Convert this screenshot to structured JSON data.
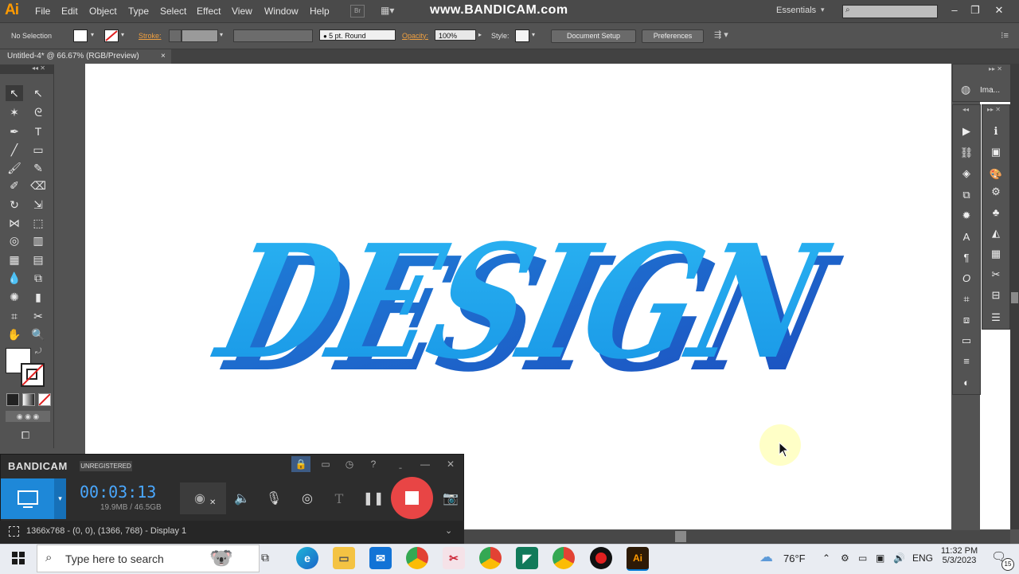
{
  "app": {
    "logo": "Ai",
    "menus": [
      "File",
      "Edit",
      "Object",
      "Type",
      "Select",
      "Effect",
      "View",
      "Window",
      "Help"
    ],
    "watermark": "www.BANDICAM.com",
    "workspace": "Essentials",
    "search_placeholder": ""
  },
  "control_bar": {
    "selection": "No Selection",
    "stroke_label": "Stroke:",
    "brush": "5 pt. Round",
    "opacity_label": "Opacity:",
    "opacity_value": "100%",
    "style_label": "Style:",
    "document_setup": "Document Setup",
    "preferences": "Preferences"
  },
  "document": {
    "tab_title": "Untitled-4* @ 66.67% (RGB/Preview)",
    "tab_close": "×",
    "artwork_text": "DESIGN"
  },
  "panels": {
    "top_label": "Ima..."
  },
  "bandicam": {
    "brand": "BANDICAM",
    "unregistered": "UNREGISTERED",
    "timer": "00:03:13",
    "file_size": "19.9MB / 46.5GB",
    "status": "1366x768 - (0, 0), (1366, 768) - Display 1"
  },
  "taskbar": {
    "search_placeholder": "Type here to search",
    "weather": "76°F",
    "language": "ENG",
    "time": "11:32 PM",
    "date": "5/3/2023",
    "notifications": "15"
  },
  "colors": {
    "accent": "#ff9a00",
    "artwork_light": "#29aef0",
    "artwork_dark": "#1c5fc7",
    "bandicam_blue": "#1e88d8",
    "record_red": "#e84545"
  }
}
